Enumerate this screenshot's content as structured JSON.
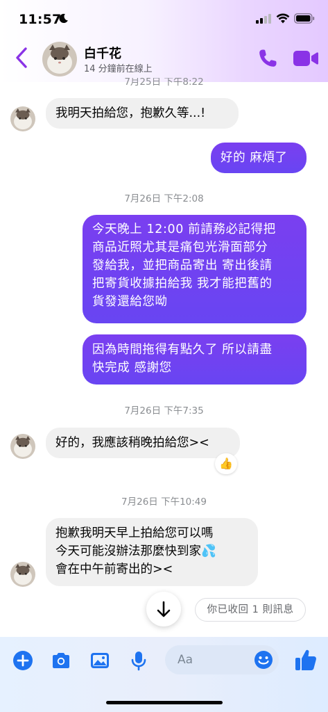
{
  "status_bar": {
    "time": "11:57"
  },
  "header": {
    "contact_name": "白千花",
    "contact_status": "14 分鐘前在線上"
  },
  "messages": [
    {
      "kind": "timestamp",
      "text": "7月25日 下午8:22"
    },
    {
      "kind": "incoming",
      "text": "我明天拍給您，抱歉久等...!"
    },
    {
      "kind": "outgoing",
      "text": "好的 麻煩了"
    },
    {
      "kind": "timestamp",
      "text": "7月26日 下午2:08"
    },
    {
      "kind": "outgoing",
      "lines": [
        "今天晚上 12:00 前請務必記得把",
        "商品近照尤其是痛包光滑面部分",
        "發給我，並把商品寄出 寄出後請",
        "把寄貨收據拍給我 我才能把舊的",
        "貨發還給您呦"
      ]
    },
    {
      "kind": "outgoing",
      "lines": [
        "因為時間拖得有點久了 所以請盡",
        "快完成 感謝您"
      ]
    },
    {
      "kind": "timestamp",
      "text": "7月26日 下午7:35"
    },
    {
      "kind": "incoming",
      "text": "好的，我應該稍晚拍給您><",
      "reaction": "👍"
    },
    {
      "kind": "timestamp",
      "text": "7月26日 下午10:49"
    },
    {
      "kind": "incoming",
      "lines": [
        "抱歉我明天早上拍給您可以嗎",
        "今天可能沒辦法那麼快到家💦",
        "會在中午前寄出的><"
      ]
    }
  ],
  "unsent_notice": "你已收回 1 則訊息",
  "composer": {
    "placeholder": "Aa"
  },
  "colors": {
    "accent": "#8a33e6",
    "outgoing_bubble": "#6f44f2",
    "incoming_bubble": "#f0f0f0",
    "composer_icon": "#1e73f0"
  },
  "icons": {
    "back": "chevron-left-icon",
    "call": "phone-icon",
    "video": "video-camera-icon",
    "add": "plus-circle-icon",
    "camera": "camera-icon",
    "gallery": "image-icon",
    "mic": "microphone-icon",
    "emoji": "smiley-icon",
    "like": "thumbs-up-icon",
    "scroll": "arrow-down-icon"
  }
}
